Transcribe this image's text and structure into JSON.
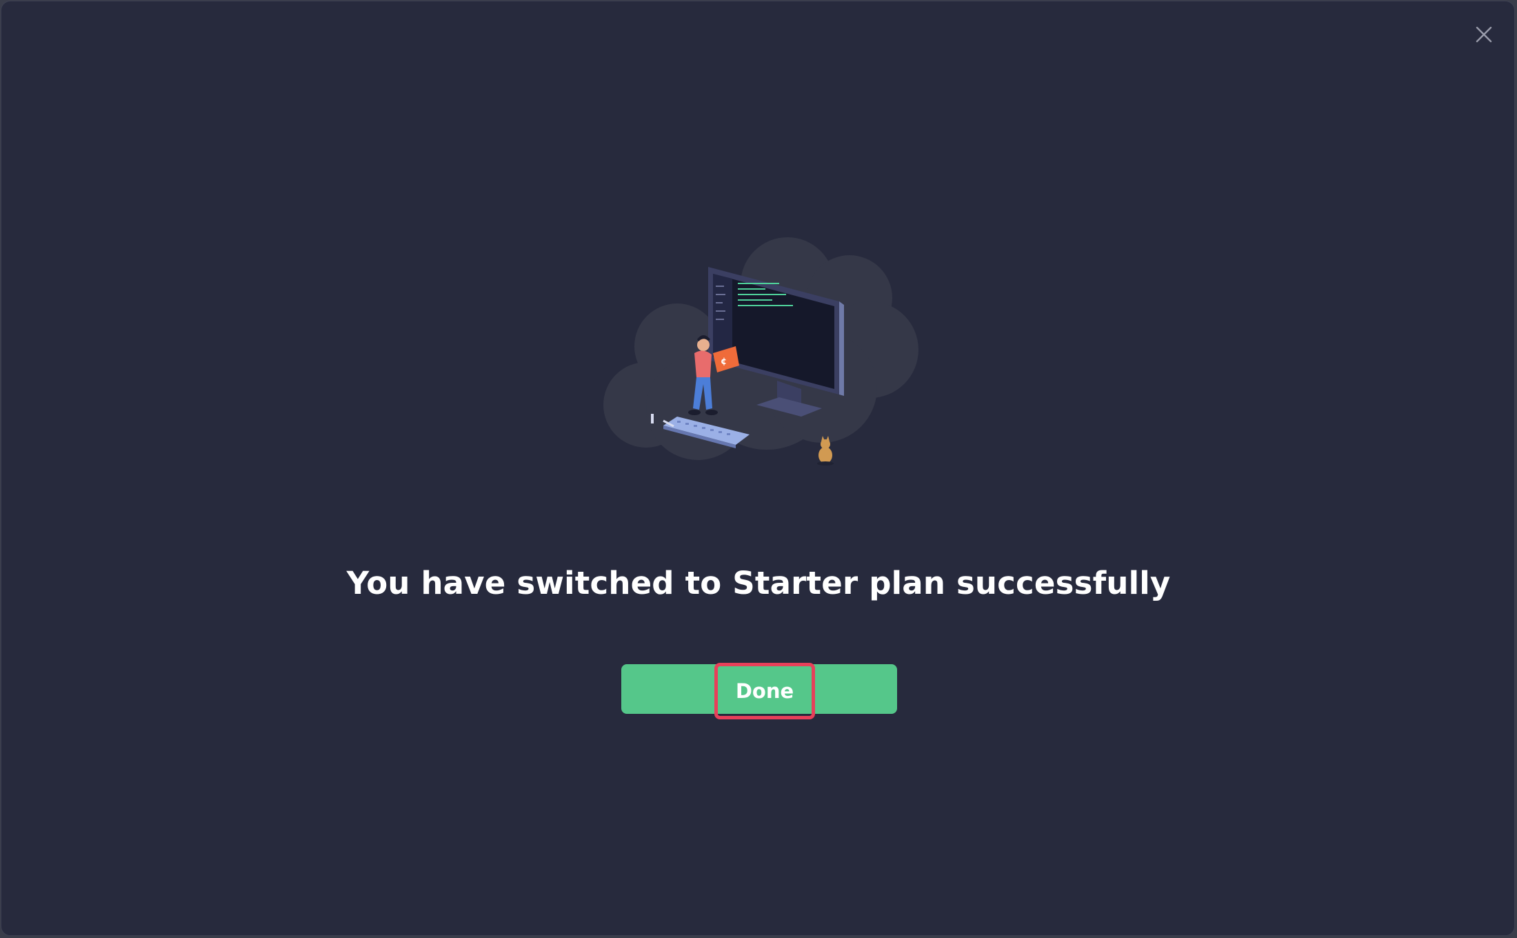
{
  "dialog": {
    "title": "You have switched to Starter plan successfully",
    "done_label": "Done",
    "close_icon": "close-icon",
    "illustration_icon": "success-illustration"
  },
  "colors": {
    "background": "#272a3d",
    "accent": "#55c78a",
    "highlight": "#e8405a",
    "text": "#ffffff"
  }
}
